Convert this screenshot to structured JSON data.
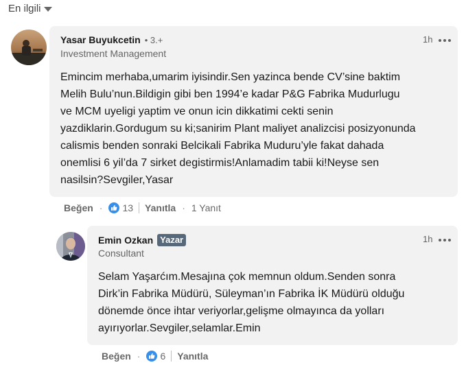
{
  "sort": {
    "label": "En ilgili",
    "icon": "caret-down-icon"
  },
  "comments": [
    {
      "author": "Yasar Buyukcetin",
      "degree": "• 3.+",
      "headline": "Investment Management",
      "time": "1h",
      "text": "Emincim merhaba,umarim iyisindir.Sen yazinca bende CV’sine baktim\nMelih Bulu’nun.Bildigin gibi ben 1994’e kadar P&G Fabrika Mudurlugu\nve MCM uyeligi yaptim ve onun icin dikkatimi cekti senin\nyazdiklarin.Gordugum su ki;sanirim Plant maliyet analizcisi posizyonunda\ncalismis benden sonraki Belcikali Fabrika Muduru’yle fakat dahada\nonemlisi 6 yil’da 7 sirket degistirmis!Anlamadim tabii ki!Neyse sen\nnasilsin?Sevgiler,Yasar",
      "like_label": "Beğen",
      "like_count": "13",
      "reply_label": "Yanıtla",
      "replies_label": "1 Yanıt"
    },
    {
      "author": "Emin Ozkan",
      "badge": "Yazar",
      "headline": "Consultant",
      "time": "1h",
      "text": "Selam Yaşarćım.Mesajına çok memnun oldum.Senden sonra\nDirk’in Fabrika Müdürü, Süleyman’ın Fabrika İK Müdürü olduğu\ndönemde önce ihtar veriyorlar,gelişme olmayınca da yolları\nayırıyorlar.Sevgiler,selamlar.Emin",
      "like_label": "Beğen",
      "like_count": "6",
      "reply_label": "Yanıtla"
    }
  ],
  "colors": {
    "bubble": "#f2f2f2",
    "like_blue": "#378fe9",
    "badge": "#56687a"
  }
}
